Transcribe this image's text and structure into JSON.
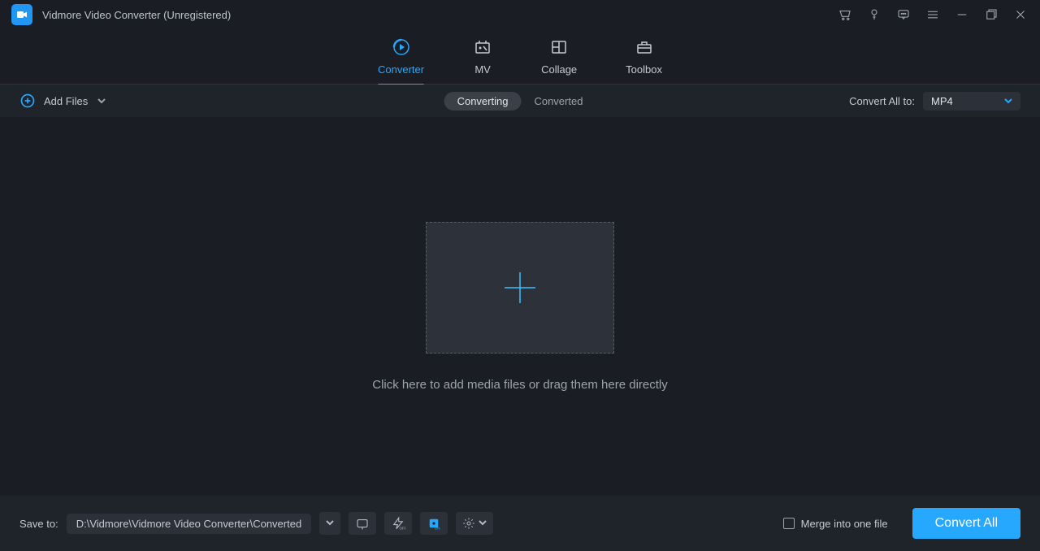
{
  "titlebar": {
    "title": "Vidmore Video Converter (Unregistered)"
  },
  "tabs": {
    "converter": "Converter",
    "mv": "MV",
    "collage": "Collage",
    "toolbox": "Toolbox"
  },
  "toolbar": {
    "add_files": "Add Files",
    "status_converting": "Converting",
    "status_converted": "Converted",
    "convert_all_to": "Convert All to:",
    "format_value": "MP4"
  },
  "main": {
    "drop_text": "Click here to add media files or drag them here directly"
  },
  "footer": {
    "save_to": "Save to:",
    "save_path": "D:\\Vidmore\\Vidmore Video Converter\\Converted",
    "merge_label": "Merge into one file",
    "convert_all": "Convert All"
  }
}
